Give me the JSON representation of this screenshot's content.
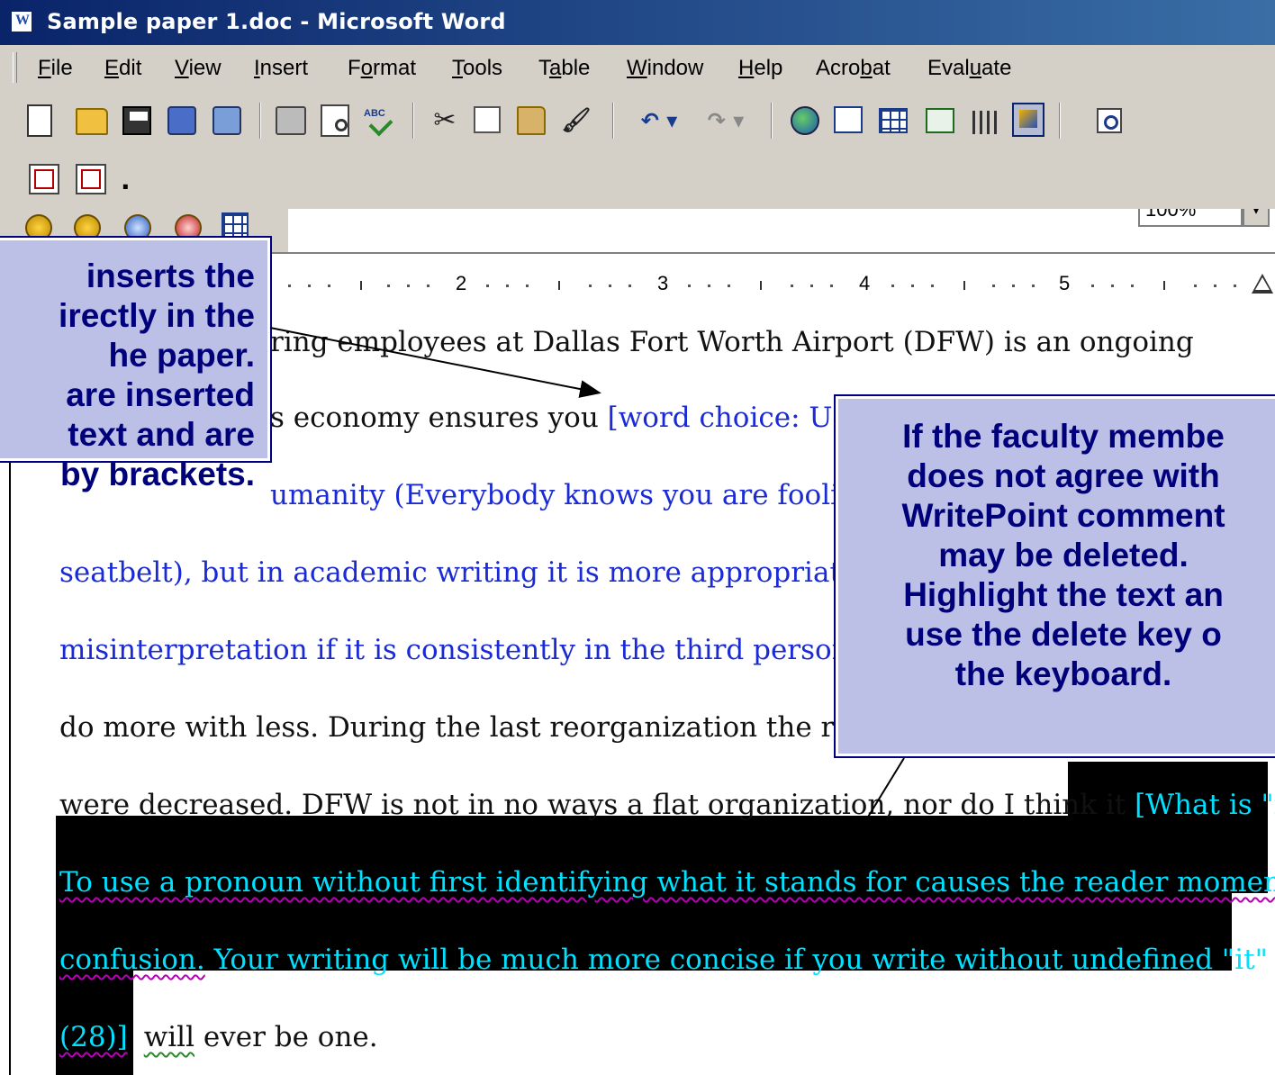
{
  "window": {
    "title": "Sample paper 1.doc - Microsoft Word"
  },
  "menu": [
    {
      "label_pre": "",
      "label_u": "F",
      "label_post": "ile"
    },
    {
      "label_pre": "",
      "label_u": "E",
      "label_post": "dit"
    },
    {
      "label_pre": "",
      "label_u": "V",
      "label_post": "iew"
    },
    {
      "label_pre": "",
      "label_u": "I",
      "label_post": "nsert"
    },
    {
      "label_pre": "F",
      "label_u": "o",
      "label_post": "rmat"
    },
    {
      "label_pre": "",
      "label_u": "T",
      "label_post": "ools"
    },
    {
      "label_pre": "T",
      "label_u": "a",
      "label_post": "ble"
    },
    {
      "label_pre": "",
      "label_u": "W",
      "label_post": "indow"
    },
    {
      "label_pre": "",
      "label_u": "H",
      "label_post": "elp"
    },
    {
      "label_pre": "Acro",
      "label_u": "b",
      "label_post": "at"
    },
    {
      "label_pre": "Eval",
      "label_u": "u",
      "label_post": "ate"
    }
  ],
  "toolbar": {
    "zoom": "100%",
    "spelling_glyph": "ABC",
    "cut_glyph": "✂",
    "paint_glyph": "🖌",
    "undo_glyph": "↶ ▾",
    "redo_glyph": "↷ ▾",
    "dropdown_glyph": "▾",
    "pdf_dropdown_glyph": "."
  },
  "ruler": {
    "labels": [
      "2",
      "3",
      "4",
      "5"
    ]
  },
  "document": {
    "line1": "ring employees at Dallas Fort Worth Airport (DFW) is an ongoing",
    "line2_black": "s economy ensures you ",
    "line2_blue": "[word choice: Use",
    "line3": "umanity (Everybody knows you are foolis",
    "line4": "seatbelt), but in academic writing it is more appropriate ar",
    "line5": "misinterpretation if it is consistently in the third person (h",
    "line6": "do more with less. During the last reorganization the ranks",
    "line7_black": "were decreased. DFW is not in no ways a flat organization, nor do I think it ",
    "line7_hl": "[What is \"it\"?",
    "line8": "To use a pronoun without first identifying what it stands for causes the reader momentary",
    "line9_squig": "confusion.",
    "line9_rest": " Your writing will be much more concise if you write without undefined \"it\"",
    "line10_hl": "(28)]",
    "line10_squig": "will",
    "line10_rest": " ever be one."
  },
  "callouts": {
    "left": [
      "inserts the",
      "irectly in the",
      "he paper.",
      "are inserted",
      "text and are",
      "by brackets."
    ],
    "right": [
      "If the faculty membe",
      "does not agree with",
      "WritePoint comment",
      "may be deleted.",
      "Highlight the text an",
      "use the delete key o",
      "the keyboard."
    ]
  }
}
